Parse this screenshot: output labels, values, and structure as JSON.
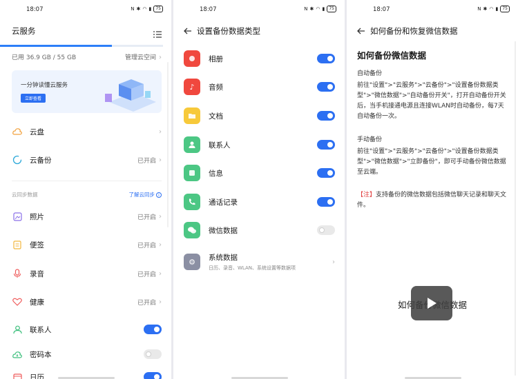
{
  "status": {
    "time": "18:07",
    "battery": "75"
  },
  "cloud": {
    "title": "云服务",
    "storage_used": "已用 36.9 GB / 55 GB",
    "manage_label": "管理云空间",
    "banner_text": "一分钟读懂云服务",
    "banner_button": "立即查看",
    "items_top": [
      {
        "label": "云盘",
        "state": ""
      },
      {
        "label": "云备份",
        "state": "已开启"
      }
    ],
    "sync_section": "云同步数据",
    "sync_link": "了解云同步",
    "items_sync": [
      {
        "label": "照片",
        "state": "已开启"
      },
      {
        "label": "便签",
        "state": "已开启"
      },
      {
        "label": "录音",
        "state": "已开启"
      },
      {
        "label": "健康",
        "state": "已开启"
      },
      {
        "label": "联系人",
        "state": "on"
      },
      {
        "label": "密码本",
        "state": "off"
      },
      {
        "label": "日历",
        "state": "on"
      }
    ]
  },
  "backup": {
    "title": "设置备份数据类型",
    "items": [
      {
        "label": "相册",
        "on": true,
        "color": "#f0483e"
      },
      {
        "label": "音频",
        "on": true,
        "color": "#f0483e"
      },
      {
        "label": "文档",
        "on": true,
        "color": "#f7c93a"
      },
      {
        "label": "联系人",
        "on": true,
        "color": "#4cc784"
      },
      {
        "label": "信息",
        "on": true,
        "color": "#4cc784"
      },
      {
        "label": "通话记录",
        "on": true,
        "color": "#4cc784"
      },
      {
        "label": "微信数据",
        "on": false,
        "color": "#4cc784"
      }
    ],
    "system": {
      "label": "系统数据",
      "sub": "日历、录音、WLAN、系统设置等数据项"
    }
  },
  "guide": {
    "header": "如何备份和恢复微信数据",
    "heading": "如何备份微信数据",
    "auto_title": "自动备份",
    "auto_text": "前往\"设置\">\"云服务\">\"云备份\">\"设置备份数据类型\">\"微信数据\">\"自动备份开关\"，打开自动备份开关后，当手机接通电源且连接WLAN时自动备份，每7天自动备份一次。",
    "manual_title": "手动备份",
    "manual_text": "前往\"设置\">\"云服务\">\"云备份\">\"设置备份数据类型\">\"微信数据\">\"立即备份\"，即可手动备份微信数据至云端。",
    "note_tag": "【注】",
    "note_text": "支持备份的微信数据包括微信聊天记录和聊天文件。",
    "video_title": "如何备份微信数据"
  }
}
